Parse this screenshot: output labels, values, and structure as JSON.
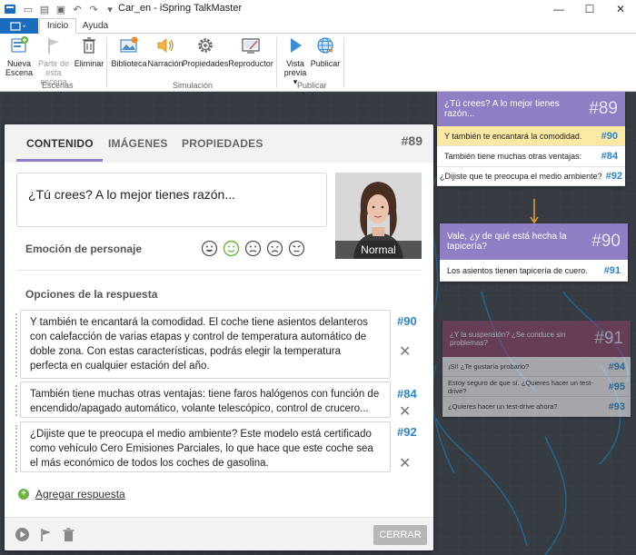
{
  "window": {
    "title": "Car_en - iSpring TalkMaster",
    "controls": {
      "minimize": "—",
      "maximize": "☐",
      "close": "✕"
    }
  },
  "quick_access": [
    "new-doc",
    "open",
    "save",
    "undo",
    "redo",
    "customize"
  ],
  "ribbon": {
    "tabs": [
      {
        "label": "Inicio",
        "active": true
      },
      {
        "label": "Ayuda",
        "active": false
      }
    ],
    "groups": [
      {
        "label": "Escenas",
        "buttons": [
          {
            "label": "Nueva Escena",
            "icon": "new-scene-icon",
            "enabled": true
          },
          {
            "label": "Partir de esta escena",
            "icon": "start-flag-icon",
            "enabled": false
          },
          {
            "label": "Eliminar",
            "icon": "trash-icon",
            "enabled": true
          }
        ]
      },
      {
        "label": "Simulación",
        "buttons": [
          {
            "label": "Biblioteca",
            "icon": "library-icon",
            "enabled": true
          },
          {
            "label": "Narración",
            "icon": "speaker-icon",
            "enabled": true
          },
          {
            "label": "Propiedades",
            "icon": "gear-icon",
            "enabled": true
          },
          {
            "label": "Reproductor",
            "icon": "player-icon",
            "enabled": true
          }
        ]
      },
      {
        "label": "Publicar",
        "buttons": [
          {
            "label": "Vista previa",
            "icon": "play-icon",
            "enabled": true
          },
          {
            "label": "Publicar",
            "icon": "globe-icon",
            "enabled": true
          }
        ]
      }
    ]
  },
  "scenes": [
    {
      "number": "#89",
      "question": "¿Tú crees? A lo mejor tienes razón...",
      "responses": [
        {
          "text": "Y también te encantará la comodidad.",
          "target": "#90",
          "highlighted": true
        },
        {
          "text": "También tiene muchas otras ventajas:",
          "target": "#84",
          "highlighted": false
        },
        {
          "text": "¿Dijiste que te preocupa el medio ambiente?",
          "target": "#92",
          "highlighted": false
        }
      ]
    },
    {
      "number": "#90",
      "question": "Vale, ¿y de qué está hecha la tapicería?",
      "responses": [
        {
          "text": "Los asientos tienen tapicería de cuero.",
          "target": "#91"
        }
      ]
    },
    {
      "number": "#91",
      "question": "¿Y la suspensión? ¿Se conduce sin problemas?",
      "responses": [
        {
          "text": "¡Sí! ¿Te gustaría probarlo?",
          "target": "#94"
        },
        {
          "text": "Estoy seguro de que sí. ¿Quieres hacer un test-drive?",
          "target": "#95"
        },
        {
          "text": "¿Quieres hacer un test-drive ahora?",
          "target": "#93"
        }
      ]
    }
  ],
  "editor": {
    "tabs": [
      "CONTENIDO",
      "IMÁGENES",
      "PROPIEDADES"
    ],
    "active_tab": "CONTENIDO",
    "scene_number": "#89",
    "speech_text": "¿Tú crees? A lo mejor tienes razón...",
    "portrait_label": "Normal",
    "emotion_label": "Emoción de personaje",
    "emotions": [
      "happy",
      "smile",
      "neutral",
      "sad",
      "angry"
    ],
    "selected_emotion": "smile",
    "options_label": "Opciones de la respuesta",
    "responses": [
      {
        "text": "Y también te encantará la comodidad. El coche tiene asientos delanteros con calefacción de varias etapas y control de temperatura automático de doble zona. Con estas características, podrás elegir la temperatura perfecta en cualquier estación del año.",
        "target": "#90"
      },
      {
        "text": "También tiene muchas otras ventajas: tiene faros halógenos con función de encendido/apagado automático, volante telescópico, control de crucero...",
        "target": "#84"
      },
      {
        "text": "¿Dijiste que te preocupa el medio ambiente? Este modelo está certificado como vehículo Cero Emisiones Parciales, lo que hace que este coche sea el más económico de todos los coches de gasolina.",
        "target": "#92"
      }
    ],
    "add_response": "Agregar respuesta",
    "close_button": "CERRAR",
    "accent_color": "#8f7ec4",
    "link_color": "#2b86c9"
  }
}
